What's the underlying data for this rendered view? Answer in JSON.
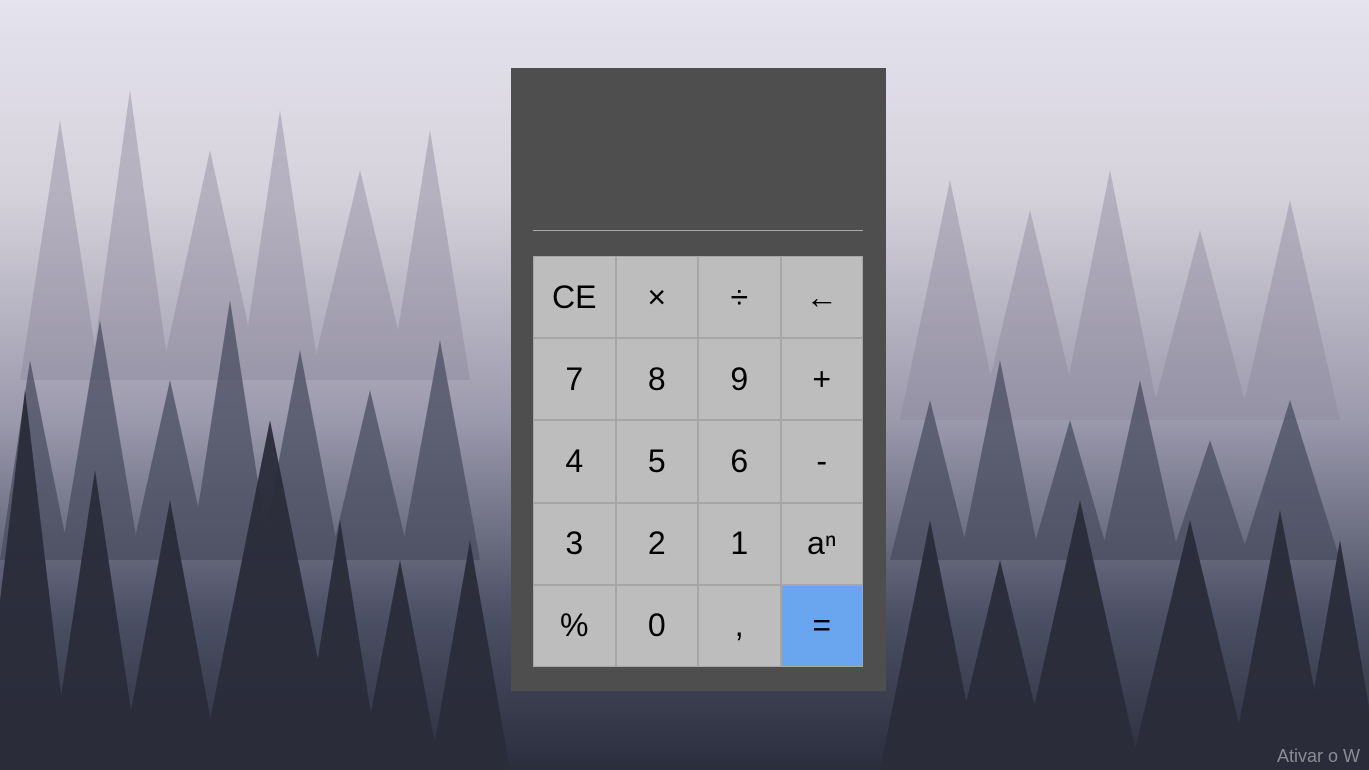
{
  "display": {
    "value": ""
  },
  "keys": [
    {
      "label": "CE",
      "name": "clear-entry-button"
    },
    {
      "label": "×",
      "name": "multiply-button"
    },
    {
      "label": "÷",
      "name": "divide-button"
    },
    {
      "label": "←",
      "name": "backspace-button"
    },
    {
      "label": "7",
      "name": "digit-7-button"
    },
    {
      "label": "8",
      "name": "digit-8-button"
    },
    {
      "label": "9",
      "name": "digit-9-button"
    },
    {
      "label": "+",
      "name": "add-button"
    },
    {
      "label": "4",
      "name": "digit-4-button"
    },
    {
      "label": "5",
      "name": "digit-5-button"
    },
    {
      "label": "6",
      "name": "digit-6-button"
    },
    {
      "label": "-",
      "name": "subtract-button"
    },
    {
      "label": "3",
      "name": "digit-3-button"
    },
    {
      "label": "2",
      "name": "digit-2-button"
    },
    {
      "label": "1",
      "name": "digit-1-button"
    },
    {
      "label": "aⁿ",
      "name": "power-button"
    },
    {
      "label": "%",
      "name": "percent-button"
    },
    {
      "label": "0",
      "name": "digit-0-button"
    },
    {
      "label": ",",
      "name": "decimal-button"
    },
    {
      "label": "=",
      "name": "equals-button"
    }
  ],
  "watermark": {
    "text": "Ativar o W"
  },
  "colors": {
    "panel": "#4e4e4e",
    "key": "#bdbdbd",
    "equals_key": "#69a6ef"
  }
}
